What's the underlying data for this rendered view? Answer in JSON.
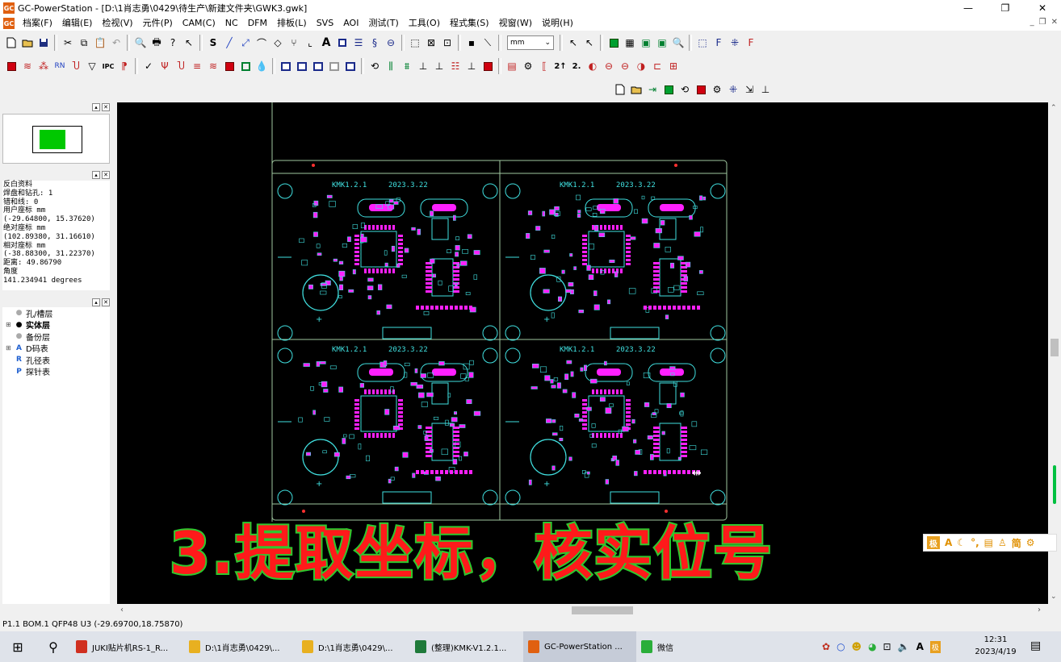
{
  "window": {
    "app_icon": "GC",
    "title": "GC-PowerStation - [D:\\1肖志勇\\0429\\待生产\\新建文件夹\\GWK3.gwk]",
    "minimize": "—",
    "maximize": "❐",
    "close": "✕"
  },
  "menu": [
    {
      "label": "档案(F)"
    },
    {
      "label": "编辑(E)"
    },
    {
      "label": "检视(V)"
    },
    {
      "label": "元件(P)"
    },
    {
      "label": "CAM(C)"
    },
    {
      "label": "NC"
    },
    {
      "label": "DFM"
    },
    {
      "label": "排板(L)"
    },
    {
      "label": "SVS"
    },
    {
      "label": "AOI"
    },
    {
      "label": "测试(T)"
    },
    {
      "label": "工具(O)"
    },
    {
      "label": "程式集(S)"
    },
    {
      "label": "视窗(W)"
    },
    {
      "label": "说明(H)"
    }
  ],
  "mdi_controls": [
    "_",
    "❐",
    "✕"
  ],
  "toolbar": {
    "units_combo": "mm",
    "text_tool": "A",
    "text_s": "S"
  },
  "panels": {
    "pin_btn": "▴",
    "close_btn": "✕"
  },
  "info_panel": [
    "反白资料",
    "焊盘和钻孔: 1",
    "错和线: 0",
    "用户座标 mm",
    "(-29.64800, 15.37620)",
    "绝对座标 mm",
    "(102.89380, 31.16610)",
    "相对座标 mm",
    "(-38.88300, 31.22370)",
    "距离: 49.86790",
    "角度",
    "141.234941 degrees"
  ],
  "layer_tree": [
    {
      "label": "孔/槽层",
      "expander": "",
      "icon": "dot-icon"
    },
    {
      "label": "实体层",
      "expander": "⊞",
      "icon": "dot-icon"
    },
    {
      "label": "备份层",
      "expander": "",
      "icon": "dot-icon"
    },
    {
      "label": "D码表",
      "expander": "⊞",
      "icon": "dcode-icon"
    },
    {
      "label": "孔径表",
      "expander": "",
      "icon": "drill-table-icon"
    },
    {
      "label": "探针表",
      "expander": "",
      "icon": "probe-table-icon"
    }
  ],
  "pcb": {
    "board_label_1": "KMK1.2.1",
    "date_1": "2023.3.22",
    "board_label_4": "KMK1.2.1",
    "date_4": "2023.3.22"
  },
  "overlay_caption": "3.提取坐标，核实位号",
  "ime_bar": [
    "极",
    "A",
    "☾",
    "°,",
    "▤",
    "♙",
    "简",
    "⚙"
  ],
  "status_text": "P1.1 BOM.1 QFP48 U3  (-29.69700,18.75870)",
  "taskbar": {
    "start": "⊞",
    "search": "⚲",
    "items": [
      {
        "label": "JUKI贴片机RS-1_R...",
        "color": "#d03020"
      },
      {
        "label": "D:\\1肖志勇\\0429\\...",
        "color": "#e8b020"
      },
      {
        "label": "D:\\1肖志勇\\0429\\...",
        "color": "#e8b020"
      },
      {
        "label": "(整理)KMK-V1.2.1...",
        "color": "#1f7a3a"
      },
      {
        "label": "GC-PowerStation ...",
        "color": "#e06010"
      },
      {
        "label": "微信",
        "color": "#2aae3a"
      }
    ],
    "tray_text": "A",
    "time": "12:31",
    "date": "2023/4/19"
  }
}
